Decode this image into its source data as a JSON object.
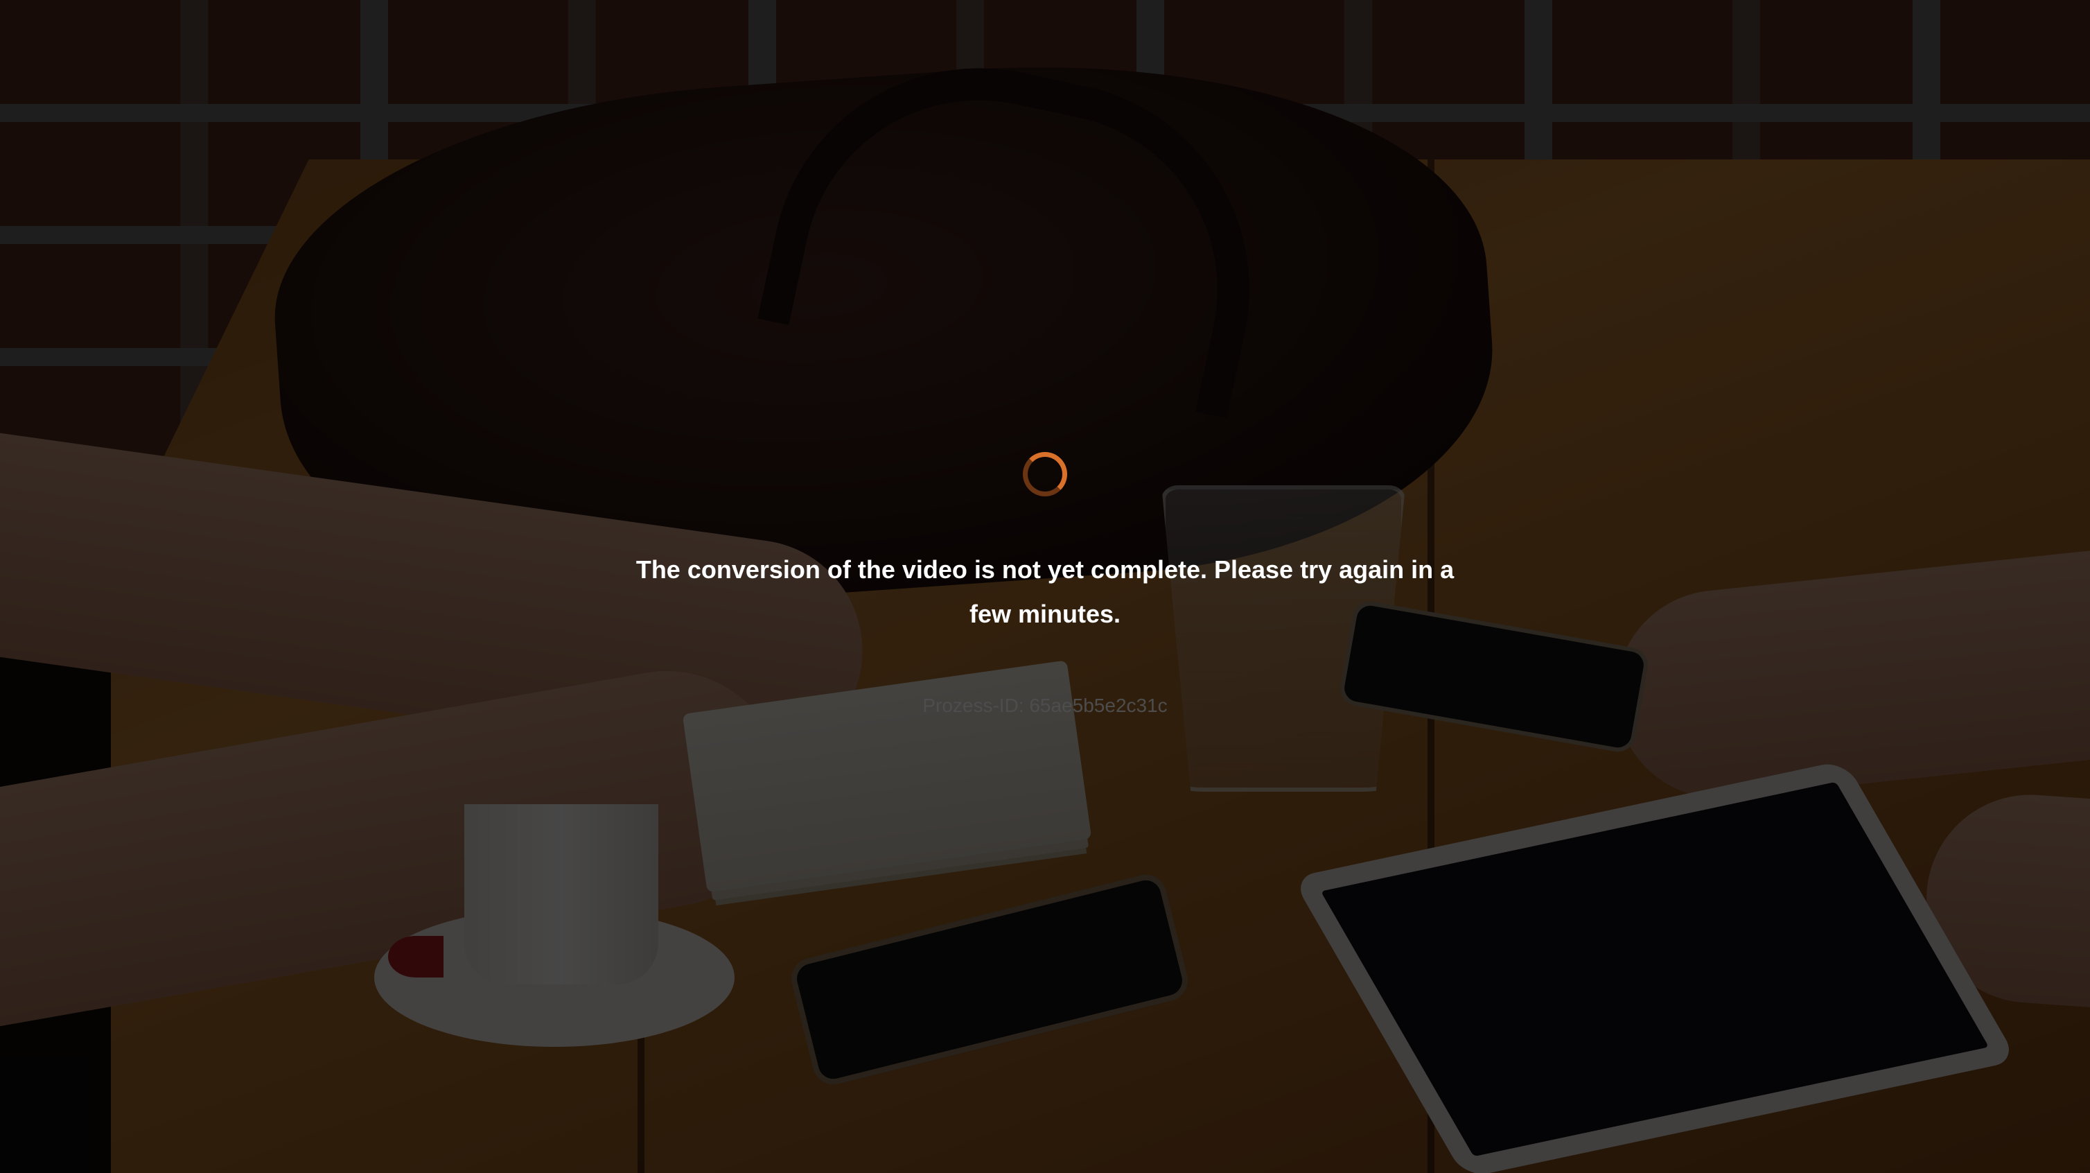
{
  "status": {
    "message": "The conversion of the video is not yet complete. Please try again in a few minutes.",
    "process_id_label": "Prozess-ID:",
    "process_id_value": "65ae5b5e2c31c"
  },
  "colors": {
    "spinner_accent": "#d9712a",
    "message_text": "#ffffff",
    "process_id_text": "#4d4d4d",
    "overlay": "rgba(0,0,0,0.72)"
  },
  "icons": {
    "spinner": "loading-spinner-icon"
  }
}
